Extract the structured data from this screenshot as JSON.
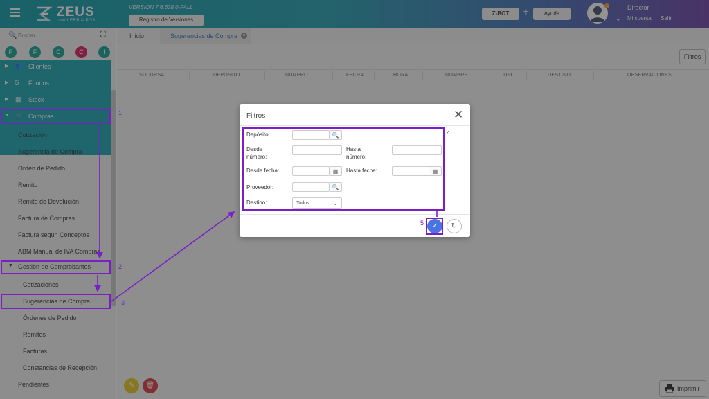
{
  "header": {
    "logo_text": "ZEUS",
    "logo_sub": "cloud ERP & POS",
    "version": "VERSION 7.6.638.0-FALL",
    "registro_label": "Registro de Versiones",
    "zbot_label": "Z-BOT",
    "plus": "+",
    "ayuda_label": "Ayuda",
    "user_name": "Director",
    "mi_cuenta": "Mi cuenta",
    "salir": "Salir",
    "user_chevron": "⌄"
  },
  "sidebar": {
    "search_placeholder": "Buscar...",
    "search_icon": "🔍",
    "expand_icon": "⛶",
    "shortcuts": [
      "P",
      "F",
      "C",
      "C",
      "I"
    ],
    "top_items": [
      {
        "label": "Clientes",
        "icon": "users-icon",
        "glyph": "👥",
        "caret": "▶"
      },
      {
        "label": "Fondos",
        "icon": "dollar-icon",
        "glyph": "$",
        "caret": "▶"
      },
      {
        "label": "Stock",
        "icon": "box-icon",
        "glyph": "▦",
        "caret": "▶"
      },
      {
        "label": "Compras",
        "icon": "cart-icon",
        "glyph": "🛒",
        "caret": "▼"
      }
    ],
    "compras_items": [
      "Cotización",
      "Sugerencia de Compra",
      "Orden de Pedido",
      "Remito",
      "Remito de Devolución",
      "Factura de Compras",
      "Factura según Conceptos",
      "ABM Manual de IVA Compras"
    ],
    "gestion_label": "Gestión de Comprobantes",
    "gestion_caret": "▼",
    "gestion_items": [
      "Cotizaciones",
      "Sugerencias de Compra",
      "Órdenes de Pedido",
      "Remitos",
      "Facturas",
      "Constancias de Recepción"
    ],
    "pendientes_label": "Pendientes"
  },
  "tabs": {
    "inicio": "Inicio",
    "sugerencias": "Sugerencias de Compra",
    "close": "×"
  },
  "toolbar": {
    "filtros_label": "Filtros",
    "imprimir_label": "Imprimir",
    "edit_glyph": "✎",
    "delete_glyph": "🗑"
  },
  "table": {
    "columns": [
      "SUCURSAL",
      "DEPÓSITO",
      "NÚMERO",
      "FECHA",
      "HORA",
      "NOMBRE",
      "TIPO",
      "DESTINO",
      "OBSERVACIONES"
    ]
  },
  "modal": {
    "title": "Filtros",
    "close": "✕",
    "deposito_label": "Depósito:",
    "desde_numero_label_1": "Desde",
    "desde_numero_label_2": "número:",
    "hasta_numero_label_1": "Hasta",
    "hasta_numero_label_2": "número:",
    "desde_fecha_label": "Desde fecha:",
    "hasta_fecha_label": "Hasta fecha:",
    "proveedor_label": "Proveedor:",
    "destino_label": "Destino:",
    "destino_value": "Todos",
    "search_glyph": "🔍",
    "calendar_glyph": "▦",
    "select_chevron": "⌄",
    "ok_glyph": "✓",
    "reset_glyph": "↻"
  },
  "annotations": {
    "numbers": [
      "1",
      "2",
      "3",
      "4",
      "5"
    ],
    "color": "#7a1fc6"
  },
  "colors": {
    "menu_teal": "#14a3b0",
    "accent_blue": "#4a74e0",
    "tab_active_text": "#2a72b5"
  }
}
